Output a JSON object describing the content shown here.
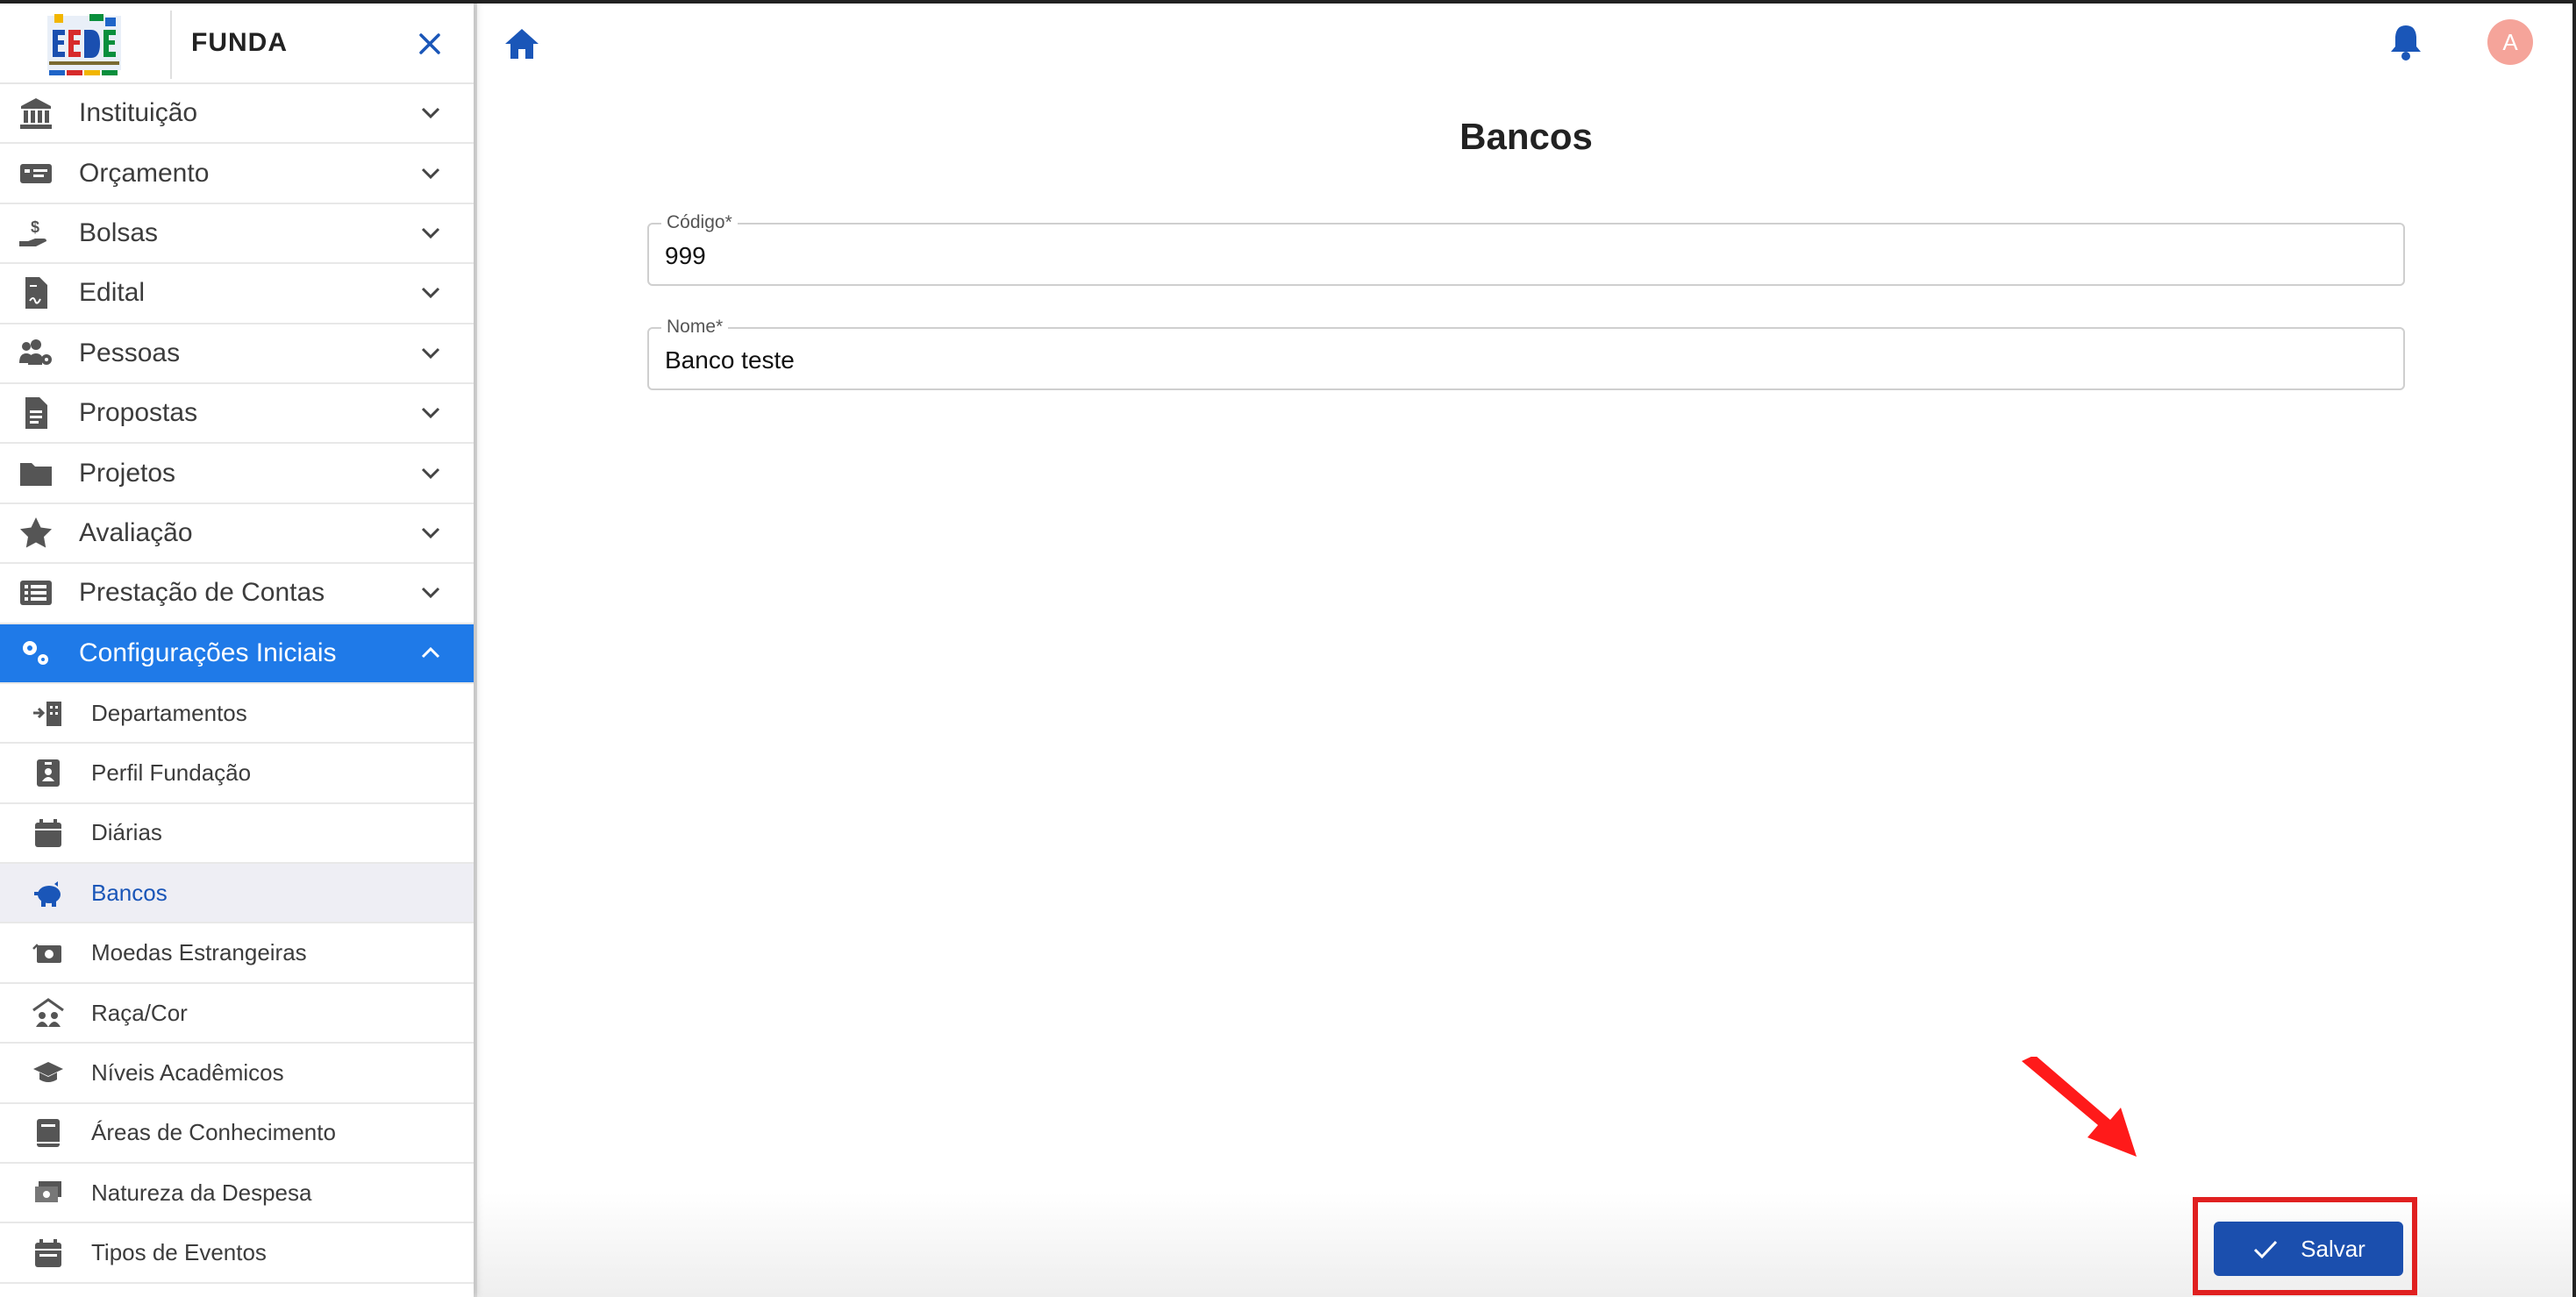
{
  "sidebar": {
    "brand": "FUNDA",
    "menu": [
      {
        "label": "Instituição",
        "icon": "bank-icon"
      },
      {
        "label": "Orçamento",
        "icon": "money-bill-icon"
      },
      {
        "label": "Bolsas",
        "icon": "hand-holding-dollar-icon"
      },
      {
        "label": "Edital",
        "icon": "file-contract-icon"
      },
      {
        "label": "Pessoas",
        "icon": "users-gear-icon"
      },
      {
        "label": "Propostas",
        "icon": "file-lines-icon"
      },
      {
        "label": "Projetos",
        "icon": "folder-icon"
      },
      {
        "label": "Avaliação",
        "icon": "star-icon"
      },
      {
        "label": "Prestação de Contas",
        "icon": "list-icon"
      },
      {
        "label": "Configurações Iniciais",
        "icon": "gears-icon",
        "expanded": true
      }
    ],
    "submenu": [
      {
        "label": "Departamentos",
        "icon": "building-arrow-icon"
      },
      {
        "label": "Perfil Fundação",
        "icon": "id-badge-icon"
      },
      {
        "label": "Diárias",
        "icon": "calendar-icon"
      },
      {
        "label": "Bancos",
        "icon": "piggy-bank-icon",
        "selected": true
      },
      {
        "label": "Moedas Estrangeiras",
        "icon": "money-exchange-icon"
      },
      {
        "label": "Raça/Cor",
        "icon": "people-roof-icon"
      },
      {
        "label": "Níveis Acadêmicos",
        "icon": "graduation-cap-icon"
      },
      {
        "label": "Áreas de Conhecimento",
        "icon": "book-icon"
      },
      {
        "label": "Natureza da Despesa",
        "icon": "money-bills-icon"
      },
      {
        "label": "Tipos de Eventos",
        "icon": "calendar-days-icon"
      }
    ]
  },
  "header": {
    "avatar_initial": "A"
  },
  "main": {
    "title": "Bancos",
    "fields": {
      "codigo": {
        "label": "Código",
        "required_mark": "*",
        "value": "999"
      },
      "nome": {
        "label": "Nome",
        "required_mark": "*",
        "value": "Banco teste"
      }
    },
    "save_label": "Salvar"
  },
  "colors": {
    "accent": "#1f7ae8",
    "button": "#1b4fae",
    "selected_text": "#1a56b8",
    "highlight": "#e02020",
    "avatar": "#f5a49a"
  }
}
